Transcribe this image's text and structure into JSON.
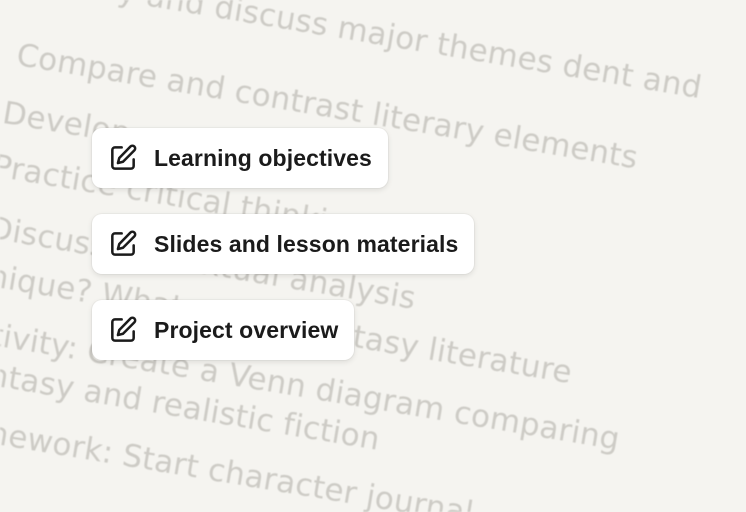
{
  "background": {
    "lines": [
      "dentify and discuss major themes          dent and",
      "Compare and contrast literary elements",
      "Develop                                 ",
      "Practice critical thinking skills",
      "Discuss                          contextual analysis",
      "nique?         What makes fantasy literature",
      "tivity: Create a Venn diagram comparing",
      "ntasy and realistic fiction",
      "nework: Start character journal"
    ]
  },
  "actions": [
    {
      "label": "Learning objectives",
      "icon": "edit-icon"
    },
    {
      "label": "Slides and lesson materials",
      "icon": "edit-icon"
    },
    {
      "label": "Project overview",
      "icon": "edit-icon"
    }
  ]
}
